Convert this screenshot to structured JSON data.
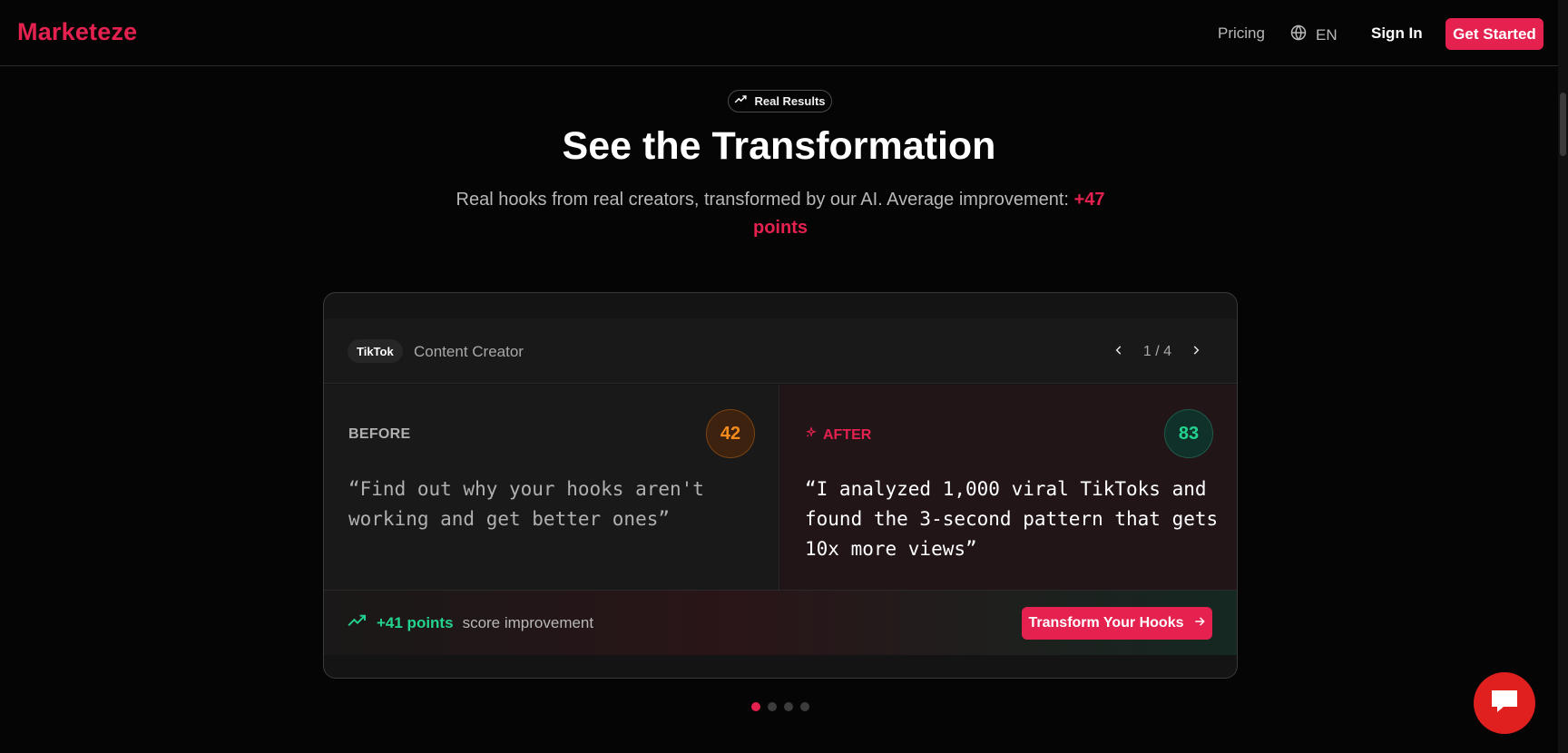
{
  "header": {
    "brand": "Marketeze",
    "nav_pricing": "Pricing",
    "lang": "EN",
    "sign_in": "Sign In",
    "cta": "Get Started"
  },
  "hero": {
    "badge": "Real Results",
    "title": "See the Transformation",
    "subtitle": "Real hooks from real creators, transformed by our AI. Average improvement:",
    "subtitle_accent": "+47 points"
  },
  "card": {
    "platform": "TikTok",
    "role": "Content Creator",
    "pager": "1 / 4",
    "before": {
      "label": "BEFORE",
      "score": "42",
      "quote": "“Find out why your hooks aren't working and get better ones”"
    },
    "after": {
      "label": "AFTER",
      "score": "83",
      "quote": "“I analyzed 1,000 viral TikToks and found the 3-second pattern that gets 10x more views”"
    },
    "improvement_points": "+41 points",
    "improvement_text": "score improvement",
    "cta": "Transform Your Hooks"
  },
  "carousel": {
    "total": 4,
    "active": 1
  },
  "colors": {
    "accent": "#e5214f",
    "success": "#23d38e",
    "warning": "#f48c1c",
    "background": "#050505"
  },
  "icons": {
    "trend": "trending-up-icon",
    "globe": "globe-icon",
    "sparkle": "sparkle-icon",
    "arrow": "arrow-right-icon",
    "chat": "chat-icon"
  }
}
